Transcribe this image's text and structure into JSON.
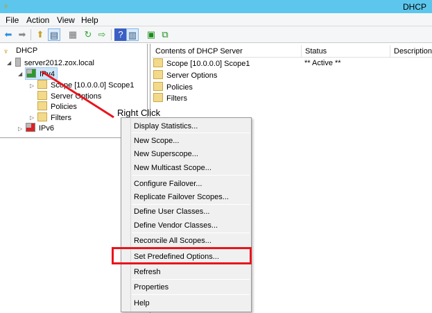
{
  "window": {
    "title": "DHCP"
  },
  "menubar": [
    "File",
    "Action",
    "View",
    "Help"
  ],
  "tree": {
    "root": "DHCP",
    "server": "server2012.zox.local",
    "ipv4": "IPv4",
    "children": [
      "Scope [10.0.0.0] Scope1",
      "Server Options",
      "Policies",
      "Filters"
    ],
    "ipv6": "IPv6"
  },
  "list": {
    "columns": [
      "Contents of DHCP Server",
      "Status",
      "Description"
    ],
    "rows": [
      {
        "name": "Scope [10.0.0.0] Scope1",
        "status": "** Active **"
      },
      {
        "name": "Server Options",
        "status": ""
      },
      {
        "name": "Policies",
        "status": ""
      },
      {
        "name": "Filters",
        "status": ""
      }
    ]
  },
  "annotation": "Right Click",
  "context_menu": [
    "Display Statistics...",
    "New Scope...",
    "New Superscope...",
    "New Multicast Scope...",
    "Configure Failover...",
    "Replicate Failover Scopes...",
    "Define User Classes...",
    "Define Vendor Classes...",
    "Reconcile All Scopes...",
    "Set Predefined Options...",
    "Refresh",
    "Properties",
    "Help"
  ],
  "colors": {
    "highlight": "#e8141c",
    "titlebar": "#5dc6ec"
  }
}
